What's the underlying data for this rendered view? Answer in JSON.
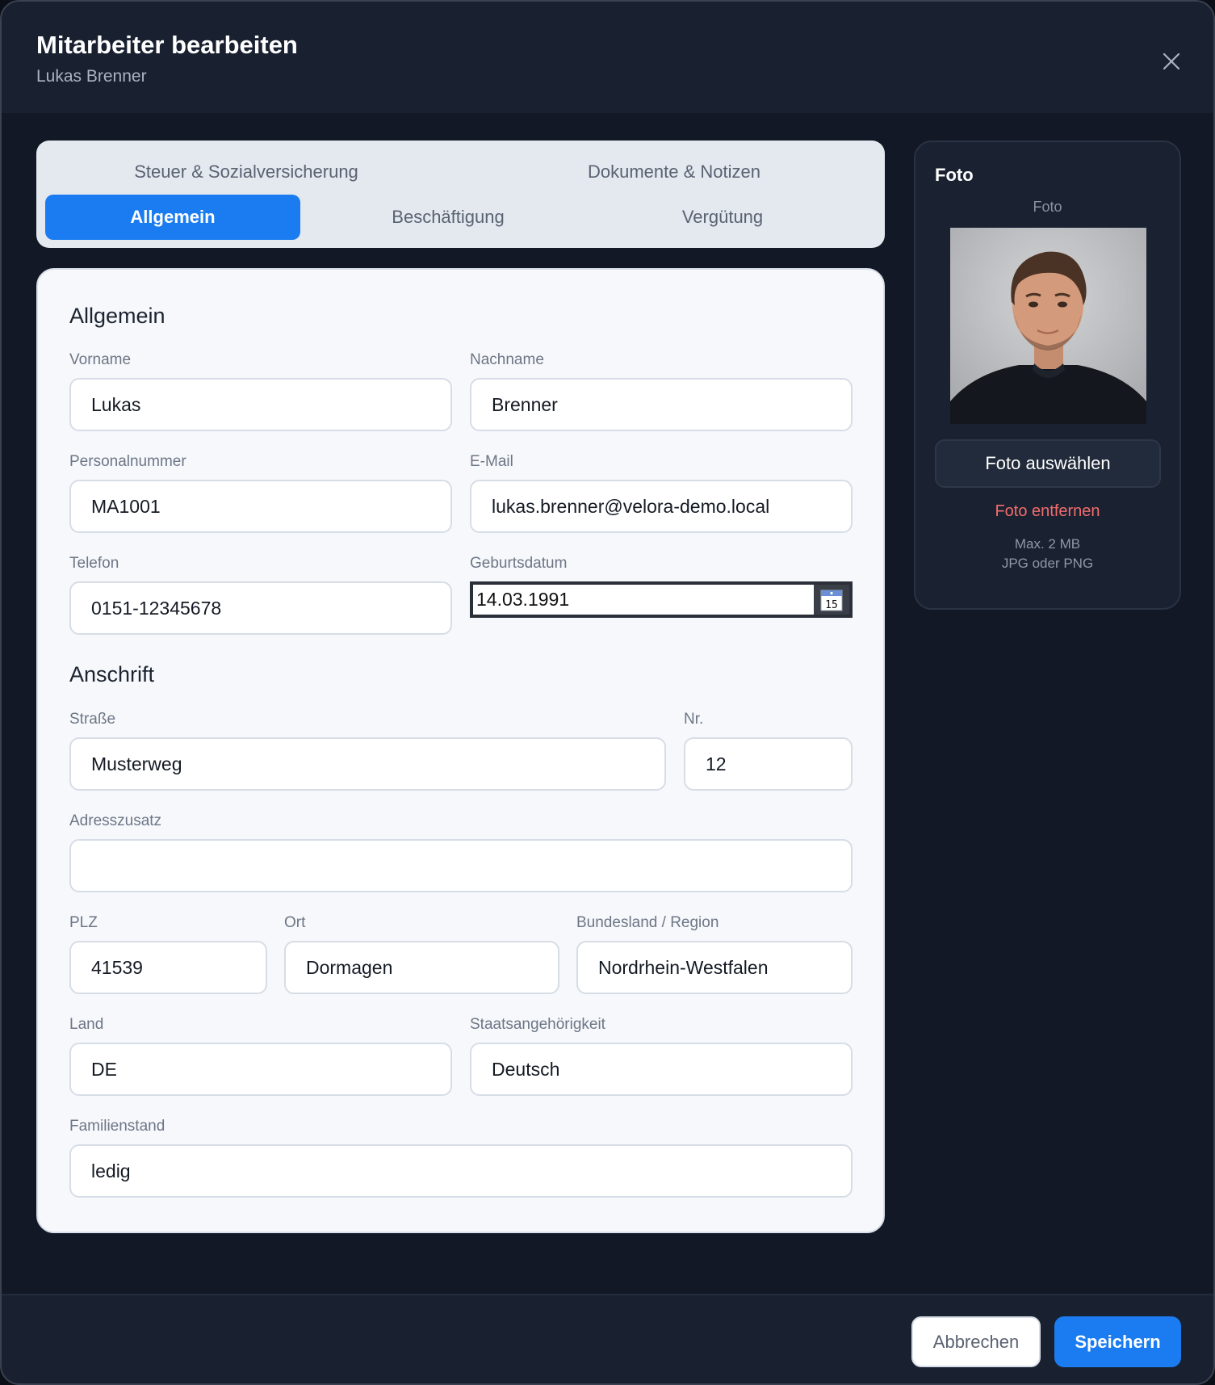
{
  "dialog": {
    "title": "Mitarbeiter bearbeiten",
    "subtitle": "Lukas Brenner"
  },
  "tabs": [
    {
      "label": "Steuer & Sozialversicherung",
      "active": false
    },
    {
      "label": "Dokumente & Notizen",
      "active": false
    },
    {
      "label": "Allgemein",
      "active": true
    },
    {
      "label": "Beschäftigung",
      "active": false
    },
    {
      "label": "Vergütung",
      "active": false
    }
  ],
  "form": {
    "section_general": "Allgemein",
    "section_address": "Anschrift",
    "fields": {
      "vorname": {
        "label": "Vorname",
        "value": "Lukas"
      },
      "nachname": {
        "label": "Nachname",
        "value": "Brenner"
      },
      "personalnummer": {
        "label": "Personalnummer",
        "value": "MA1001"
      },
      "email": {
        "label": "E-Mail",
        "value": "lukas.brenner@velora-demo.local"
      },
      "telefon": {
        "label": "Telefon",
        "value": "0151-12345678"
      },
      "geburtsdatum": {
        "label": "Geburtsdatum",
        "value": "14.03.1991",
        "calendar_day": "15"
      },
      "strasse": {
        "label": "Straße",
        "value": "Musterweg"
      },
      "nr": {
        "label": "Nr.",
        "value": "12"
      },
      "adresszusatz": {
        "label": "Adresszusatz",
        "value": ""
      },
      "plz": {
        "label": "PLZ",
        "value": "41539"
      },
      "ort": {
        "label": "Ort",
        "value": "Dormagen"
      },
      "bundesland": {
        "label": "Bundesland / Region",
        "value": "Nordrhein-Westfalen"
      },
      "land": {
        "label": "Land",
        "value": "DE"
      },
      "staatsangehoerigkeit": {
        "label": "Staatsangehörigkeit",
        "value": "Deutsch"
      },
      "familienstand": {
        "label": "Familienstand",
        "value": "ledig"
      }
    }
  },
  "photo": {
    "title": "Foto",
    "caption": "Foto",
    "choose_label": "Foto auswählen",
    "remove_label": "Foto entfernen",
    "hint_size": "Max. 2 MB",
    "hint_format": "JPG oder PNG"
  },
  "footer": {
    "cancel_label": "Abbrechen",
    "save_label": "Speichern"
  },
  "colors": {
    "accent": "#1a7cf0",
    "danger": "#f26d6d",
    "dialog_bg": "#121826"
  },
  "icons": {
    "close": "close-icon",
    "calendar": "calendar-icon"
  }
}
